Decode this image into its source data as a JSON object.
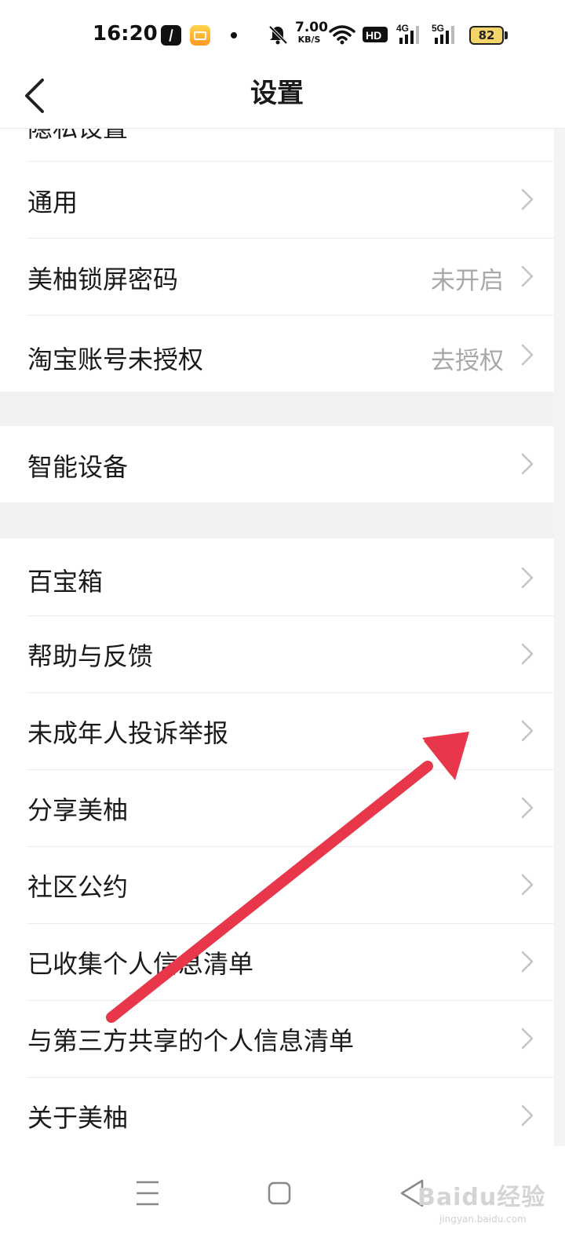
{
  "status_bar": {
    "time": "16:20",
    "net_speed_value": "7.00",
    "net_speed_unit": "KB/S",
    "battery": "82",
    "icons": [
      "app-icon-dark",
      "mail-app-icon",
      "notification-dot",
      "mute-bell-icon",
      "wifi-icon",
      "hd-icon",
      "signal-4g-icon",
      "signal-5g-icon",
      "battery-icon"
    ]
  },
  "header": {
    "title": "设置",
    "back_icon": "chevron-left-icon"
  },
  "partial_row_label": "隐私设置",
  "group1": [
    {
      "label": "通用",
      "value": ""
    },
    {
      "label": "美柚锁屏密码",
      "value": "未开启"
    },
    {
      "label": "淘宝账号未授权",
      "value": "去授权"
    }
  ],
  "group2": [
    {
      "label": "智能设备",
      "value": ""
    }
  ],
  "group3": [
    {
      "label": "百宝箱",
      "value": ""
    },
    {
      "label": "帮助与反馈",
      "value": ""
    },
    {
      "label": "未成年人投诉举报",
      "value": ""
    },
    {
      "label": "分享美柚",
      "value": ""
    },
    {
      "label": "社区公约",
      "value": ""
    },
    {
      "label": "已收集个人信息清单",
      "value": ""
    },
    {
      "label": "与第三方共享的个人信息清单",
      "value": ""
    },
    {
      "label": "关于美柚",
      "value": ""
    }
  ],
  "annotation": {
    "color": "#e8374a",
    "icon": "red-arrow-annotation"
  },
  "navbar": {
    "icons": [
      "menu-icon",
      "home-icon",
      "back-triangle-icon"
    ]
  },
  "watermark": {
    "main": "Baidu经验",
    "sub": "jingyan.baidu.com"
  }
}
